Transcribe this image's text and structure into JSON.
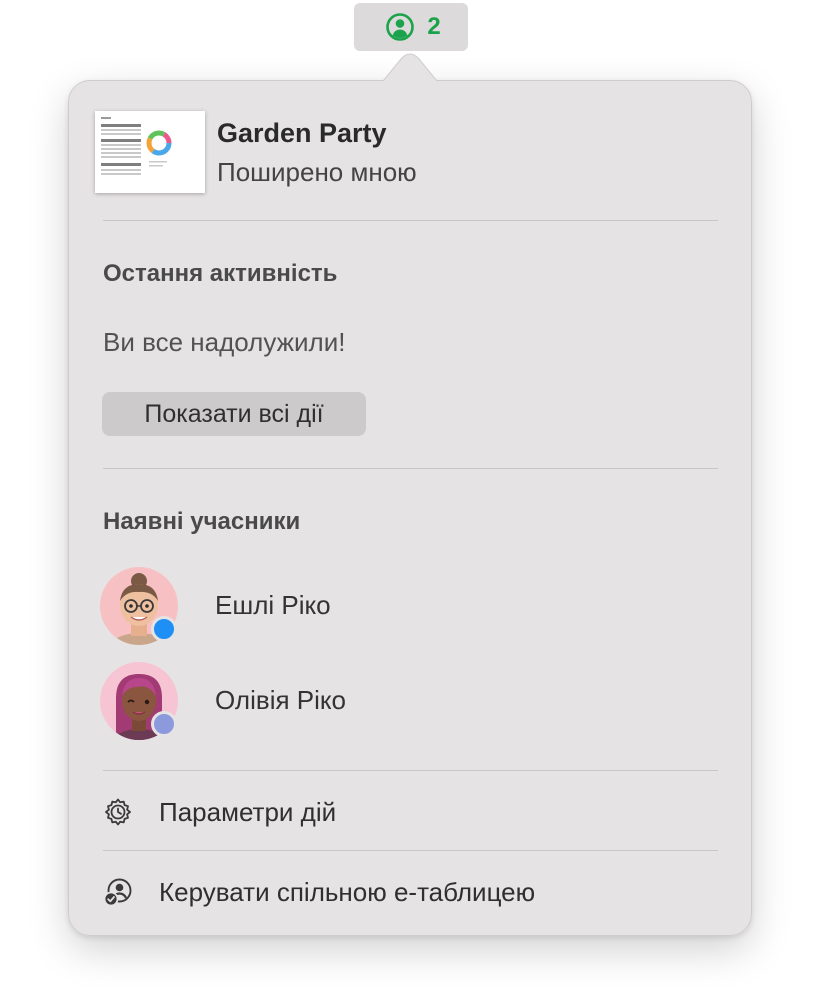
{
  "toolbar": {
    "collaboration_count": "2",
    "collaboration_icon": "person-circle-icon",
    "accent_color": "#1aa34a"
  },
  "document": {
    "title": "Garden Party",
    "subtitle": "Поширено мною",
    "thumbnail_icon": "spreadsheet-thumbnail"
  },
  "recent_activity": {
    "heading": "Остання активність",
    "status": "Ви все надолужили!",
    "show_all_label": "Показати всі дії"
  },
  "participants": {
    "heading": "Наявні учасники",
    "items": [
      {
        "name": "Ешлі Ріко",
        "avatar": "memoji-ashley",
        "presence_color": "#1e8ff5"
      },
      {
        "name": "Олівія Ріко",
        "avatar": "memoji-olivia",
        "presence_color": "#8c99dc"
      }
    ]
  },
  "menu": {
    "activity_settings": {
      "label": "Параметри дій",
      "icon": "gear-clock-icon"
    },
    "manage_shared": {
      "label": "Керувати спільною е-таблицею",
      "icon": "person-circle-check-icon"
    }
  },
  "colors": {
    "popover_background": "#e6e3e4",
    "button_background": "#cdcacb",
    "divider": "#c9c6c7"
  }
}
